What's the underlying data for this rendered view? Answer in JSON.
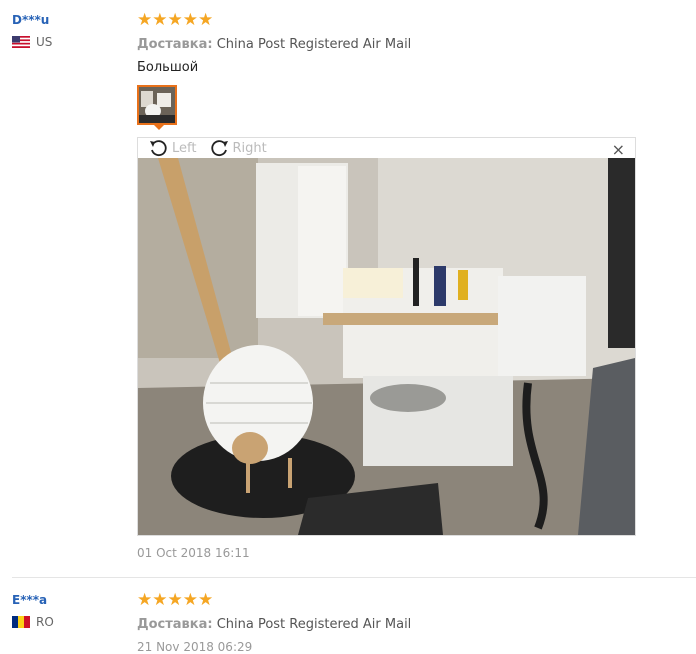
{
  "reviews": [
    {
      "user": "D***u",
      "country": "US",
      "shipping_label": "Доставка:",
      "shipping_value": "China Post Registered Air Mail",
      "comment": "Большой",
      "date": "01 Oct 2018 16:11",
      "stars": "★★★★★"
    },
    {
      "user": "E***a",
      "country": "RO",
      "shipping_label": "Доставка:",
      "shipping_value": "China Post Registered Air Mail",
      "date": "21 Nov 2018 06:29",
      "stars": "★★★★★"
    }
  ],
  "viewer": {
    "rotate_left": "Left",
    "rotate_right": "Right",
    "close": "×"
  },
  "colors": {
    "accent": "#e8711a",
    "star": "#f5a623",
    "username": "#2762b6"
  },
  "icons": [
    "rotate-left-icon",
    "rotate-right-icon",
    "close-icon",
    "flag-us-icon",
    "flag-ro-icon"
  ]
}
